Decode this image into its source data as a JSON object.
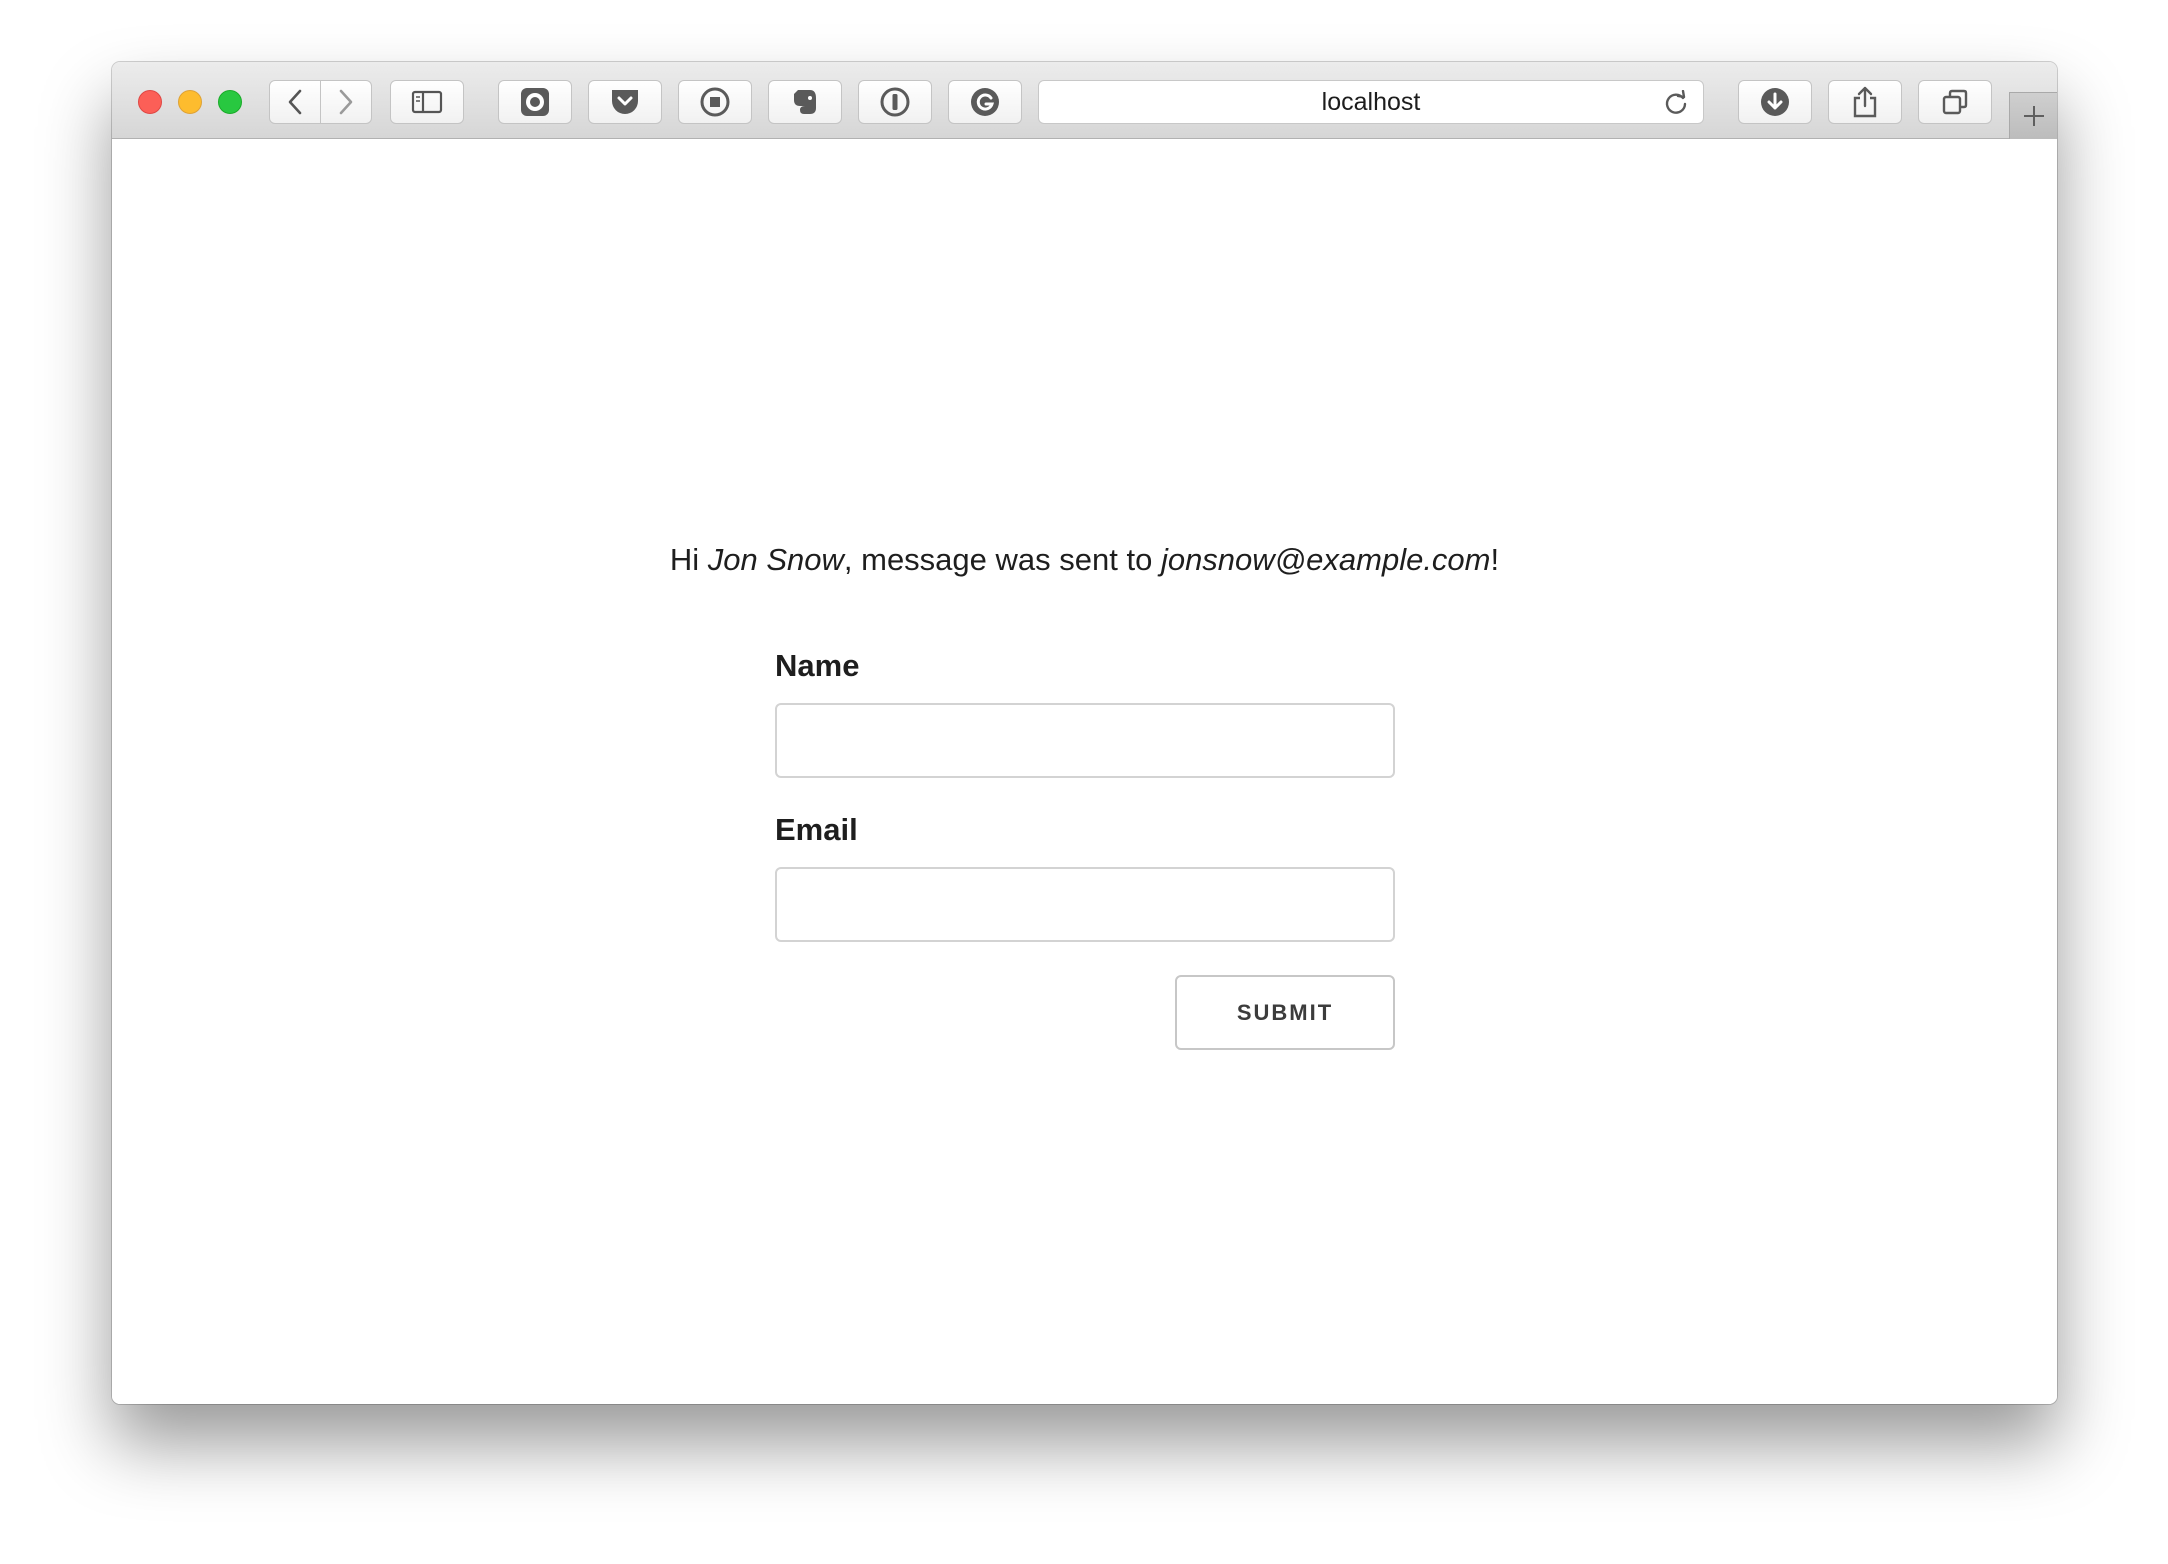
{
  "browser": {
    "address": "localhost",
    "toolbar_icons": [
      "back-icon",
      "forward-icon",
      "sidebar-icon",
      "extension-camera-icon",
      "pocket-icon",
      "stop-record-icon",
      "evernote-icon",
      "onepassword-icon",
      "grammarly-icon",
      "reload-icon",
      "download-icon",
      "share-icon",
      "tabs-icon",
      "new-tab-icon"
    ],
    "traffic_light_colors": {
      "close": "#fc5f57",
      "minimize": "#fdbc2e",
      "maximize": "#28c840"
    }
  },
  "page": {
    "greeting": {
      "prefix": "Hi ",
      "name": "Jon Snow",
      "middle": ", message was sent to ",
      "email": "jonsnow@example.com",
      "suffix": "!"
    },
    "form": {
      "name_label": "Name",
      "name_value": "",
      "email_label": "Email",
      "email_value": "",
      "submit_label": "SUBMIT"
    }
  }
}
